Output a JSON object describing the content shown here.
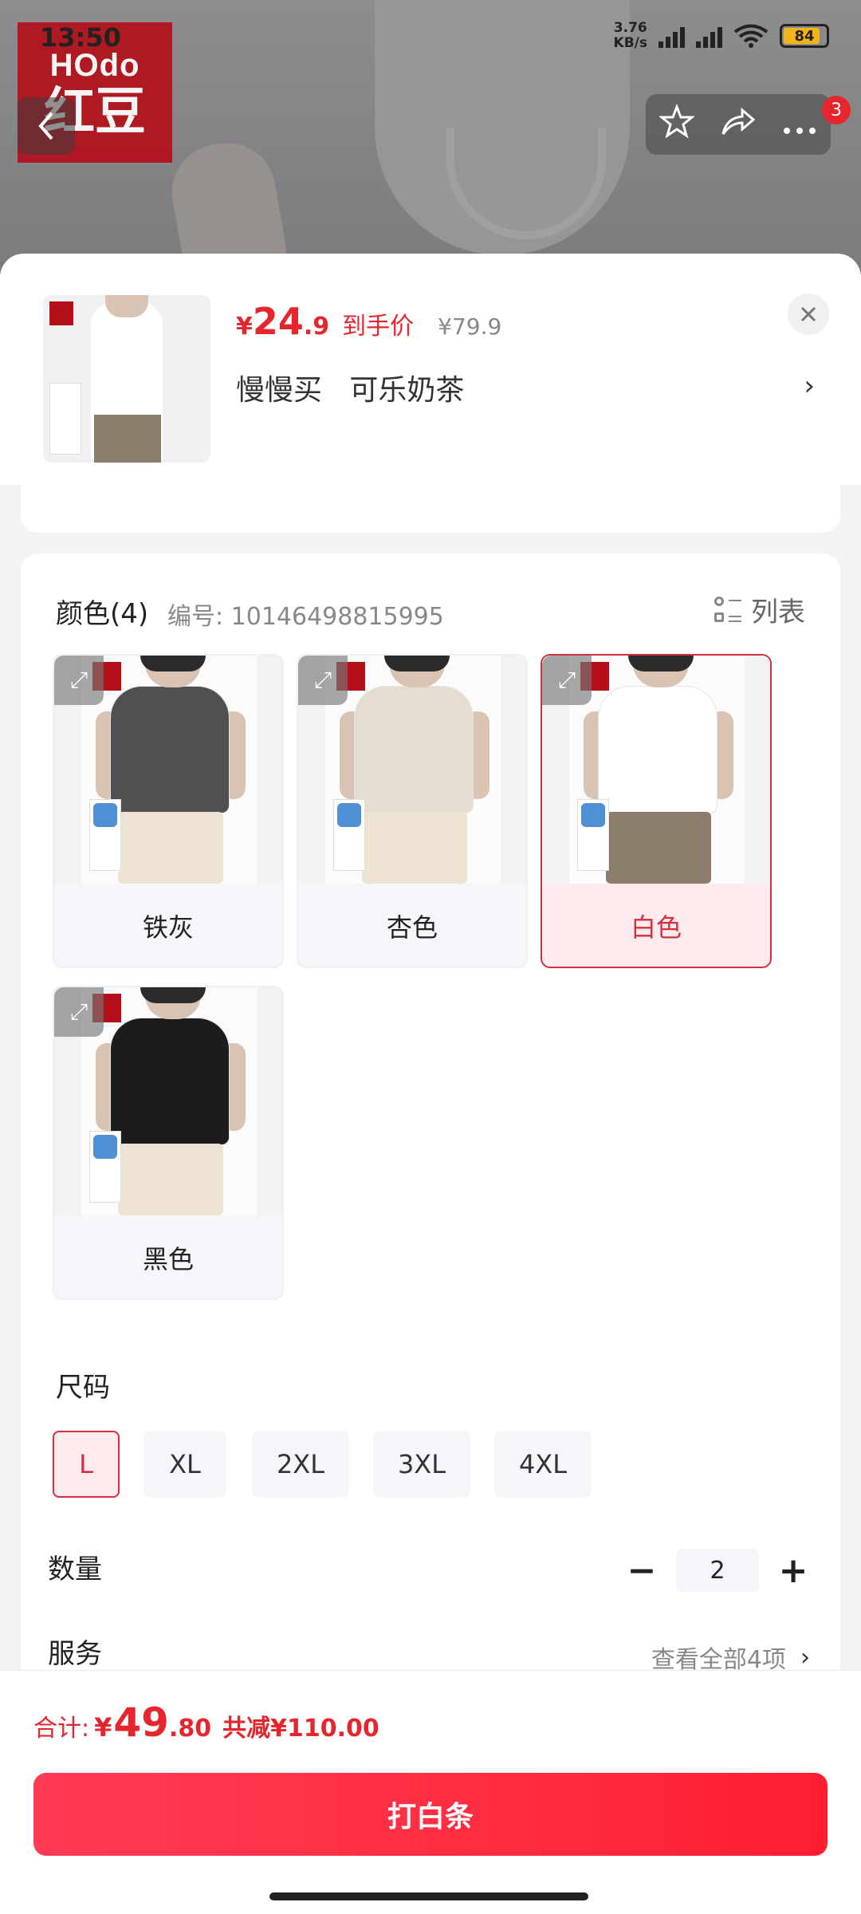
{
  "status_bar": {
    "time": "13:50",
    "net_speed": "3.76\nKB/s",
    "battery": "84"
  },
  "brand": {
    "logo_top": "HOdo",
    "logo_bottom": "红豆"
  },
  "header": {
    "back_icon": "chevron-left-icon",
    "badge_count": "3"
  },
  "sheet": {
    "product": {
      "currency": "¥",
      "price_int": "24",
      "price_dec": ".9",
      "price_tag": "到手价",
      "original_price": "¥79.9",
      "selected_spec": "慢慢买   可乐奶茶",
      "close_icon": "close-icon"
    },
    "color": {
      "title": "颜色(4)",
      "code": "编号: 10146498815995",
      "list_toggle": "列表",
      "options": [
        {
          "label": "铁灰",
          "shirt_color": "#4e5052",
          "selected": false
        },
        {
          "label": "杏色",
          "shirt_color": "#e4ddd0",
          "selected": false
        },
        {
          "label": "白色",
          "shirt_color": "#ffffff",
          "selected": true
        },
        {
          "label": "黑色",
          "shirt_color": "#1c1c1c",
          "selected": false
        }
      ]
    },
    "size": {
      "title": "尺码",
      "options": [
        "L",
        "XL",
        "2XL",
        "3XL",
        "4XL"
      ],
      "selected": "L"
    },
    "quantity": {
      "title": "数量",
      "value": "2",
      "minus": "−",
      "plus": "+"
    },
    "service": {
      "title": "服务",
      "link": "查看全部4项",
      "chevron": "›"
    }
  },
  "footer": {
    "total_label": "合计:",
    "currency": "¥",
    "total_int": "49",
    "total_dec": ".80",
    "saving": "共减¥110.00",
    "cta": "打白条"
  },
  "colors": {
    "accent": "#e5262f",
    "selected_border": "#d32f3f",
    "selected_bg": "#fdebee"
  }
}
